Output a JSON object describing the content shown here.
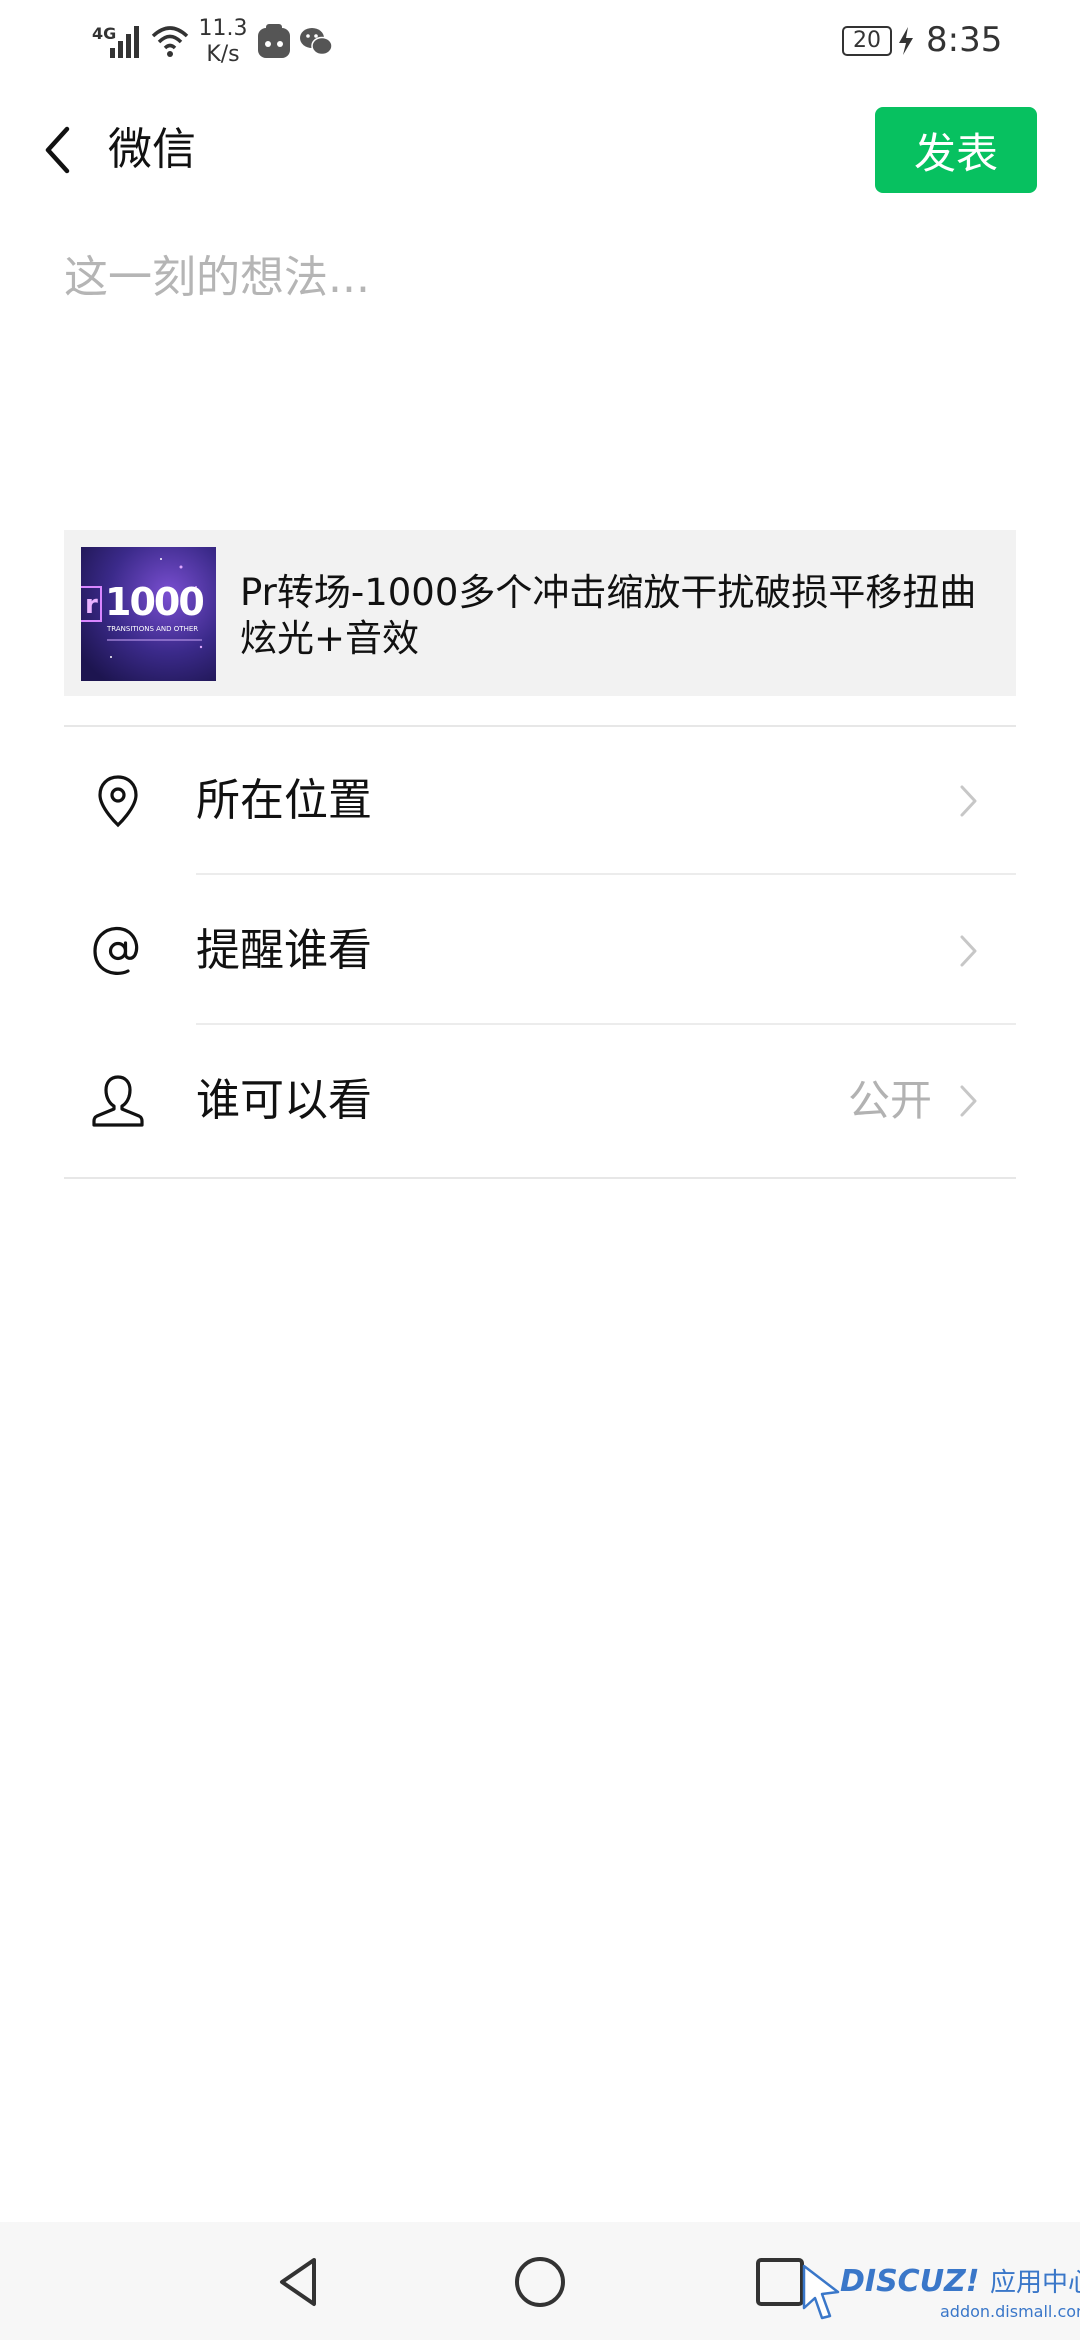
{
  "status_bar": {
    "network_type": "4G",
    "net_speed_value": "11.3",
    "net_speed_unit": "K/s",
    "battery_level": "20",
    "time": "8:35",
    "icons": [
      "signal-icon",
      "wifi-icon",
      "app-notification-icon",
      "wechat-icon",
      "battery-icon",
      "charging-icon"
    ]
  },
  "header": {
    "back_icon": "chevron-left-icon",
    "title": "微信",
    "publish_label": "发表"
  },
  "composer": {
    "value": "",
    "placeholder": "这一刻的想法..."
  },
  "link_card": {
    "thumbnail_text": "1000",
    "thumbnail_prefix": "r",
    "thumbnail_subtext": "TRANSITIONS AND OTHER",
    "title": "Pr转场-1000多个冲击缩放干扰破损平移扭曲炫光+音效"
  },
  "options": [
    {
      "icon": "location-pin-icon",
      "label": "所在位置",
      "value": ""
    },
    {
      "icon": "at-sign-icon",
      "label": "提醒谁看",
      "value": ""
    },
    {
      "icon": "person-icon",
      "label": "谁可以看",
      "value": "公开"
    }
  ],
  "nav_bar": {
    "buttons": [
      "back-triangle-icon",
      "home-circle-icon",
      "recents-square-icon"
    ]
  },
  "watermark": {
    "logo": "DISCUZ!",
    "label": "应用中心",
    "url": "addon.dismall.com"
  },
  "colors": {
    "accent_green": "#07c160",
    "placeholder_gray": "#b5b5b5",
    "card_background": "#f2f2f2",
    "divider": "#e7e7e7",
    "thumbnail_purple": "#3b2a8a",
    "watermark_blue": "#3a77c9"
  }
}
